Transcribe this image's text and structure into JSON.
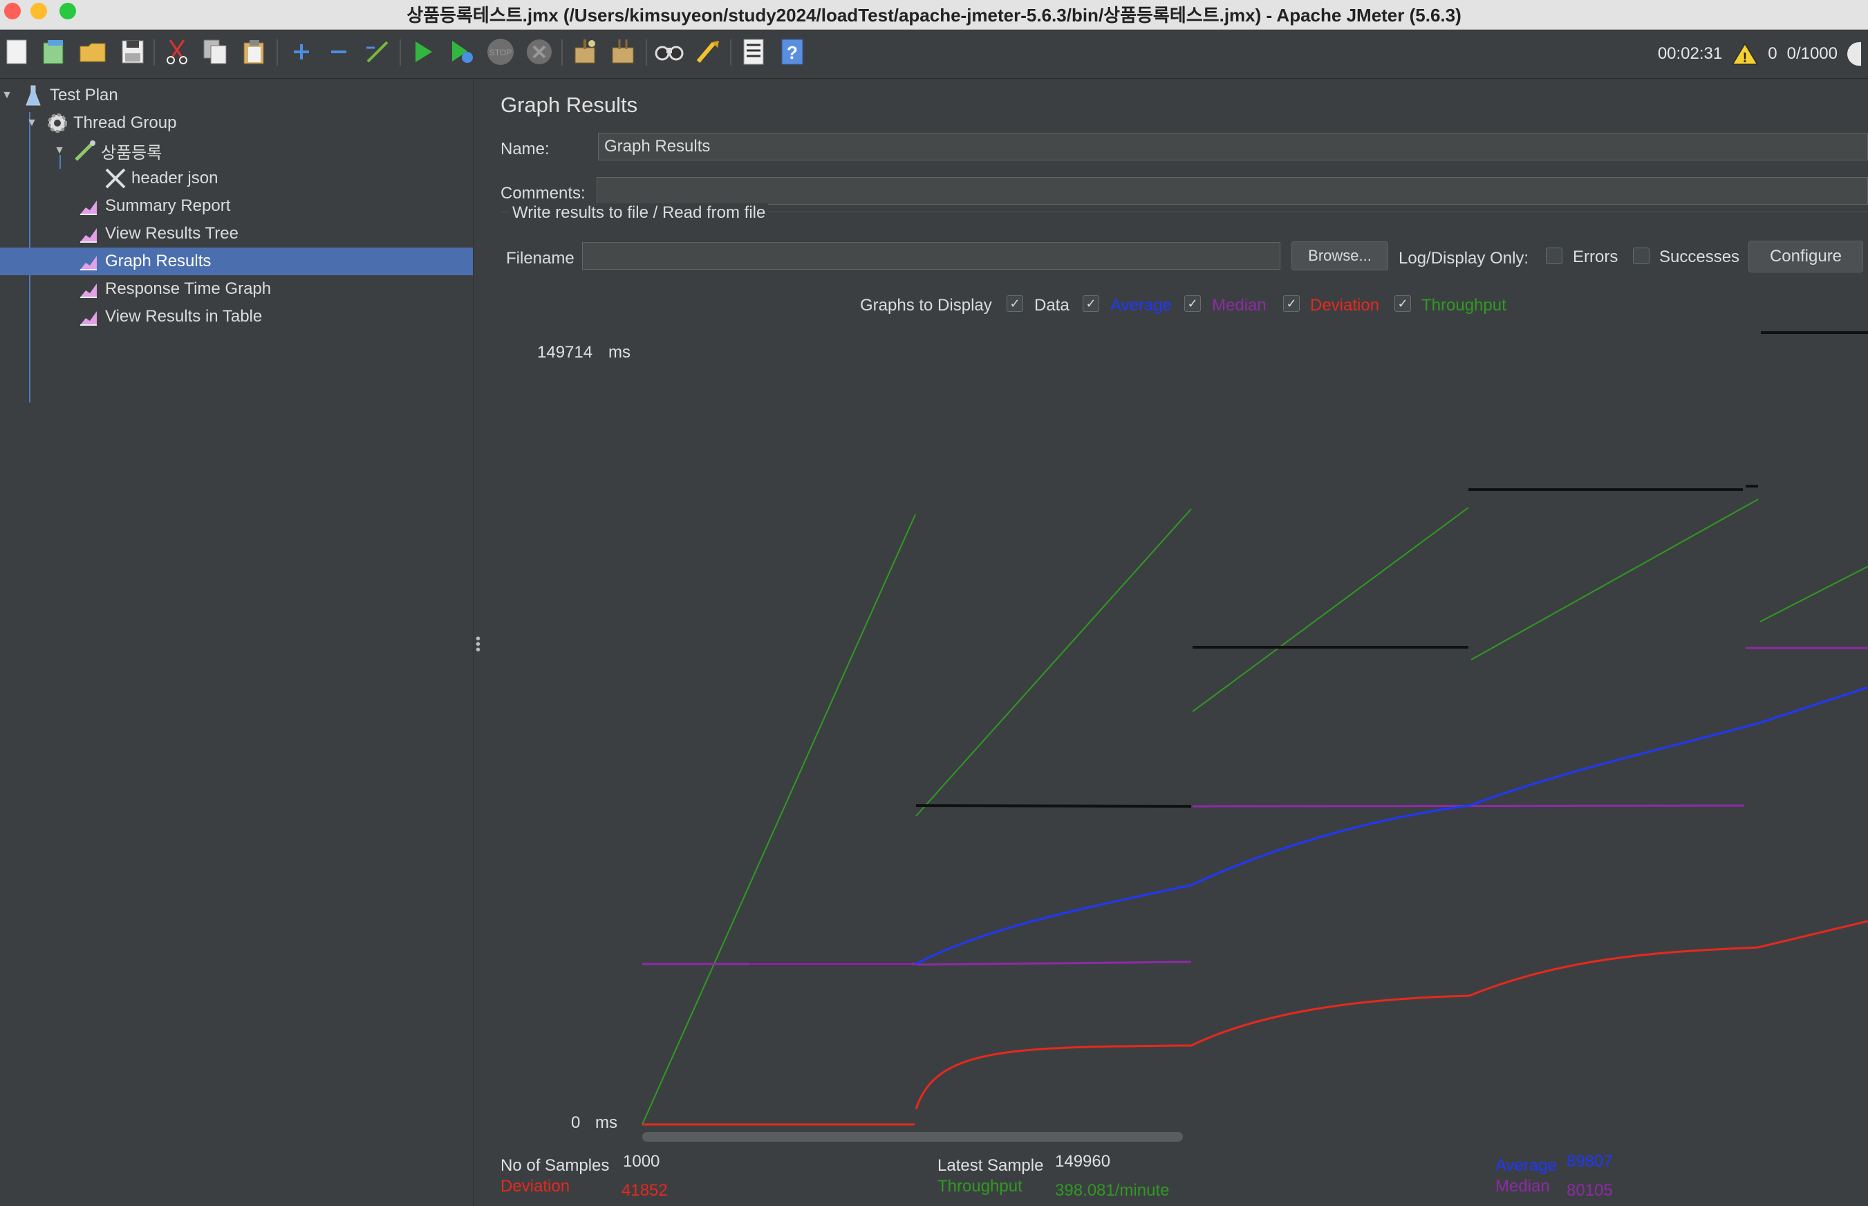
{
  "window": {
    "title": "상품등록테스트.jmx (/Users/kimsuyeon/study2024/loadTest/apache-jmeter-5.6.3/bin/상품등록테스트.jmx) - Apache JMeter (5.6.3)"
  },
  "toolbar": {
    "elapsed": "00:02:31",
    "warnings": "0",
    "threads": "0/1000",
    "icons": [
      "new-icon",
      "templates-icon",
      "open-icon",
      "save-icon",
      "cut-icon",
      "copy-icon",
      "paste-icon",
      "expand-icon",
      "collapse-icon",
      "toggle-icon",
      "start-icon",
      "start-no-pause-icon",
      "stop-icon",
      "shutdown-icon",
      "clear-icon",
      "clear-all-icon",
      "search-icon",
      "reset-search-icon",
      "function-helper-icon",
      "help-icon"
    ]
  },
  "tree": {
    "items": [
      {
        "label": "Test Plan",
        "icon": "flask-icon"
      },
      {
        "label": "Thread Group",
        "icon": "gear-icon"
      },
      {
        "label": "상품등록",
        "icon": "pipette-icon"
      },
      {
        "label": "header json",
        "icon": "wrench-icon"
      },
      {
        "label": "Summary Report",
        "icon": "graph-icon"
      },
      {
        "label": "View Results Tree",
        "icon": "graph-icon"
      },
      {
        "label": "Graph Results",
        "icon": "graph-icon"
      },
      {
        "label": "Response Time Graph",
        "icon": "graph-icon"
      },
      {
        "label": "View Results in Table",
        "icon": "graph-icon"
      }
    ]
  },
  "panel": {
    "title": "Graph Results",
    "name_label": "Name:",
    "name_value": "Graph Results",
    "comments_label": "Comments:",
    "comments_value": "",
    "file_group_label": "Write results to file / Read from file",
    "filename_label": "Filename",
    "filename_value": "",
    "browse_button": "Browse...",
    "log_display_label": "Log/Display Only:",
    "errors_label": "Errors",
    "successes_label": "Successes",
    "configure_button": "Configure"
  },
  "graph_options": {
    "label": "Graphs to Display",
    "items": [
      {
        "label": "Data",
        "checked": true,
        "color": "#dcdcdc"
      },
      {
        "label": "Average",
        "checked": true,
        "color": "#1f38ff"
      },
      {
        "label": "Median",
        "checked": true,
        "color": "#8e2aa8"
      },
      {
        "label": "Deviation",
        "checked": true,
        "color": "#e8281e"
      },
      {
        "label": "Throughput",
        "checked": true,
        "color": "#2f9a22"
      }
    ]
  },
  "chart_data": {
    "type": "line",
    "y_max_label": "149714",
    "y_unit": "ms",
    "y_min_label": "0",
    "ylim": [
      0,
      149714
    ],
    "series": [
      {
        "name": "Average",
        "color": "#1f38ff"
      },
      {
        "name": "Median",
        "color": "#8e2aa8"
      },
      {
        "name": "Deviation",
        "color": "#e8281e"
      },
      {
        "name": "Throughput",
        "color": "#2f9a22"
      }
    ]
  },
  "stats": {
    "samples_label": "No of Samples",
    "samples_value": "1000",
    "latest_label": "Latest Sample",
    "latest_value": "149960",
    "average_label": "Average",
    "average_value": "89807",
    "deviation_label": "Deviation",
    "deviation_value": "41852",
    "throughput_label": "Throughput",
    "throughput_value": "398.081/minute",
    "median_label": "Median",
    "median_value": "80105"
  }
}
